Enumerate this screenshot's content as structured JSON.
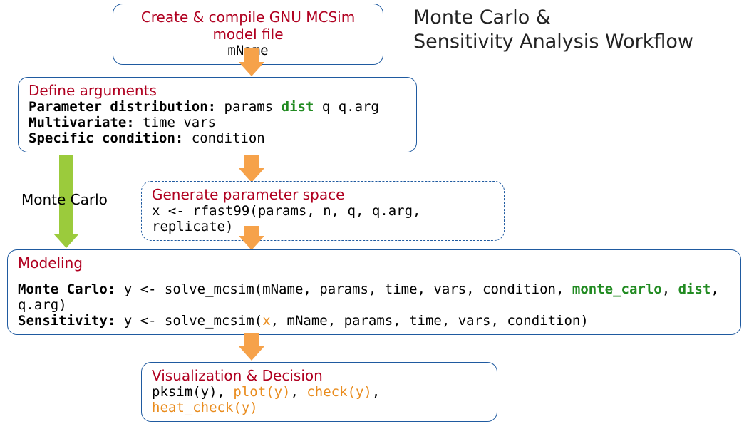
{
  "title_line1": "Monte Carlo &",
  "title_line2": "Sensitivity Analysis Workflow",
  "mc_label": "Monte Carlo",
  "box1": {
    "title": "Create & compile GNU MCSim model file",
    "sub": "mName"
  },
  "box2": {
    "title": "Define arguments",
    "l1a": "Parameter distribution:",
    "l1b": " params ",
    "l1c": "dist",
    "l1d": " q q.arg",
    "l2a": "Multivariate:",
    "l2b": " time vars",
    "l3a": "Specific condition:",
    "l3b": " condition"
  },
  "box3": {
    "title": "Generate parameter space",
    "code": "x <- rfast99(params, n, q, q.arg, replicate)"
  },
  "box4": {
    "title": "Modeling",
    "mc_a": "Monte Carlo:",
    "mc_b": " y <- solve_mcsim(mName, params, time, vars, condition, ",
    "mc_c": "monte_carlo",
    "mc_d": ", ",
    "mc_e": "dist",
    "mc_f": ", q.arg)",
    "se_a": "Sensitivity:",
    "se_b": " y <- solve_mcsim(",
    "se_c": "x",
    "se_d": ", mName, params, time, vars, condition)"
  },
  "box5": {
    "title": "Visualization & Decision",
    "a": "pksim(y), ",
    "b": "plot(y)",
    "c": ", ",
    "d": "check(y)",
    "e": ", ",
    "f": "heat_check(y)"
  }
}
